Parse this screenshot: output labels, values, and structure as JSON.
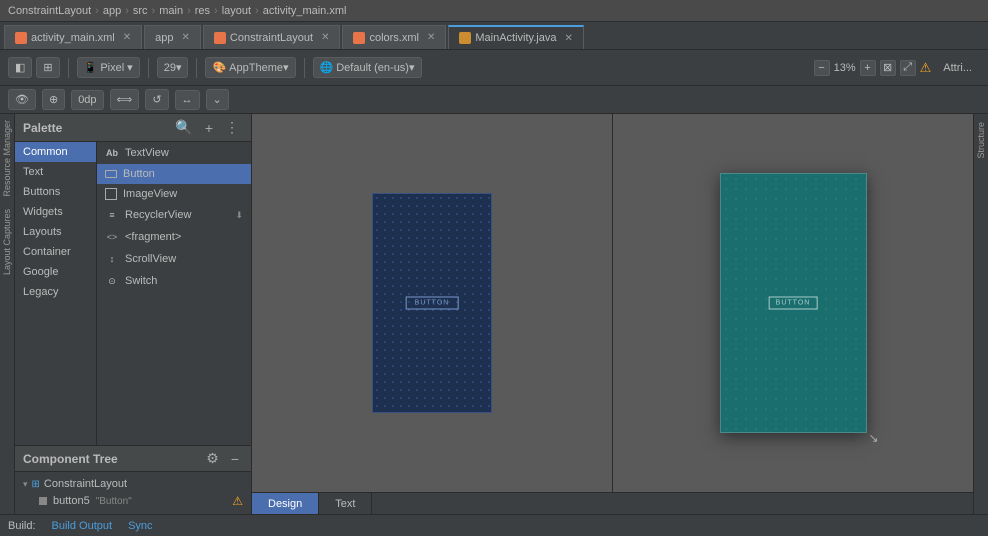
{
  "titlebar": {
    "breadcrumb": [
      "ConstraintLayout",
      "app",
      "src",
      "main",
      "res",
      "layout",
      "activity_main.xml"
    ]
  },
  "tabs": [
    {
      "id": "activity_main",
      "label": "activity_main.xml",
      "type": "xml",
      "active": false
    },
    {
      "id": "app",
      "label": "app",
      "type": "app",
      "active": false
    },
    {
      "id": "constraintlayout",
      "label": "ConstraintLayout",
      "type": "xml",
      "active": false
    },
    {
      "id": "colors",
      "label": "colors.xml",
      "type": "xml",
      "active": false
    },
    {
      "id": "mainactivity",
      "label": "MainActivity.java",
      "type": "java",
      "active": true
    }
  ],
  "toolbar": {
    "design_btn": "◧",
    "orient_btn": "⟳",
    "device_label": "Pixel",
    "api_label": "29▾",
    "theme_label": "AppTheme▾",
    "locale_label": "Default (en-us)▾",
    "zoom_out": "−",
    "zoom_level": "13%",
    "zoom_in": "+",
    "zoom_fit": "⊠",
    "warning_icon": "⚠",
    "attrib_label": "Attri..."
  },
  "secondary_toolbar": {
    "eye_btn": "👁",
    "magnet_btn": "⊕",
    "margin_val": "0dp",
    "align_btn": "⇔",
    "tool1": "⟳",
    "tool2": "↔"
  },
  "palette": {
    "title": "Palette",
    "search_placeholder": "Search",
    "categories": [
      {
        "id": "common",
        "label": "Common",
        "active": true
      },
      {
        "id": "text",
        "label": "Text"
      },
      {
        "id": "buttons",
        "label": "Buttons"
      },
      {
        "id": "widgets",
        "label": "Widgets"
      },
      {
        "id": "layouts",
        "label": "Layouts"
      },
      {
        "id": "container",
        "label": "Container"
      },
      {
        "id": "google",
        "label": "Google"
      },
      {
        "id": "legacy",
        "label": "Legacy"
      }
    ],
    "items": [
      {
        "id": "textview",
        "label": "TextView",
        "icon": "Ab"
      },
      {
        "id": "button",
        "label": "Button",
        "icon": "□",
        "selected": true
      },
      {
        "id": "imageview",
        "label": "ImageView",
        "icon": "⬜"
      },
      {
        "id": "recyclerview",
        "label": "RecyclerView",
        "icon": "≡"
      },
      {
        "id": "fragment",
        "label": "<fragment>",
        "icon": "<>"
      },
      {
        "id": "scrollview",
        "label": "ScrollView",
        "icon": "↕"
      },
      {
        "id": "switch",
        "label": "Switch",
        "icon": "⊙"
      }
    ]
  },
  "component_tree": {
    "title": "Component Tree",
    "gear_icon": "⚙",
    "minus_icon": "−",
    "root": {
      "label": "ConstraintLayout",
      "icon": "⊞",
      "children": [
        {
          "label": "button5",
          "sublabel": "\"Button\"",
          "icon": "▣",
          "has_warning": true
        }
      ]
    }
  },
  "canvas": {
    "button_label": "BUTTON"
  },
  "bottom_tabs": [
    {
      "id": "design",
      "label": "Design",
      "active": true
    },
    {
      "id": "text",
      "label": "Text",
      "active": false
    }
  ],
  "build_bar": {
    "build_label": "Build:",
    "output_label": "Build Output",
    "sync_label": "Sync"
  },
  "side_tabs": [
    "Resource Manager",
    "Layout Captures"
  ],
  "right_side": {
    "label": "Structure"
  }
}
